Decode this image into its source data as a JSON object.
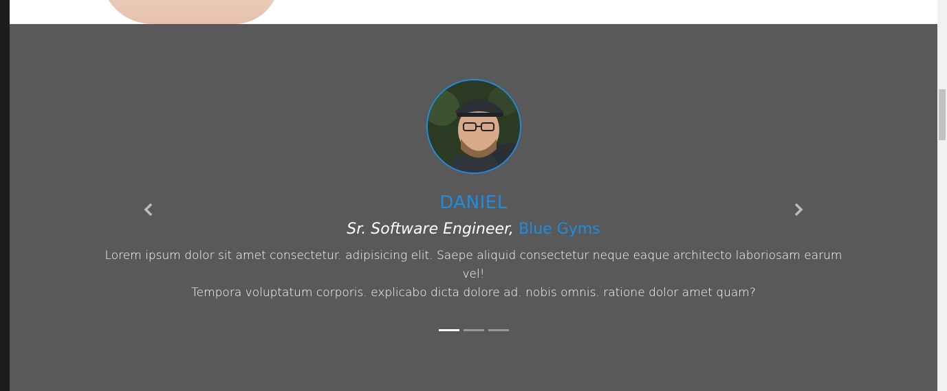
{
  "testimonial": {
    "name": "DANIEL",
    "title": "Sr. Software Engineer, ",
    "company": "Blue Gyms",
    "quote_line1": "Lorem ipsum dolor sit amet consectetur. adipisicing elit. Saepe aliquid consectetur neque eaque architecto laboriosam earum vel!",
    "quote_line2": "Tempora voluptatum corporis. explicabo dicta dolore ad. nobis omnis. ratione dolor amet quam?"
  },
  "carousel": {
    "slide_count": 3,
    "active_index": 0
  },
  "colors": {
    "accent": "#1e8de0",
    "section_bg": "#595959",
    "text": "#ffffff"
  },
  "icons": {
    "prev": "chevron-left-icon",
    "next": "chevron-right-icon"
  }
}
